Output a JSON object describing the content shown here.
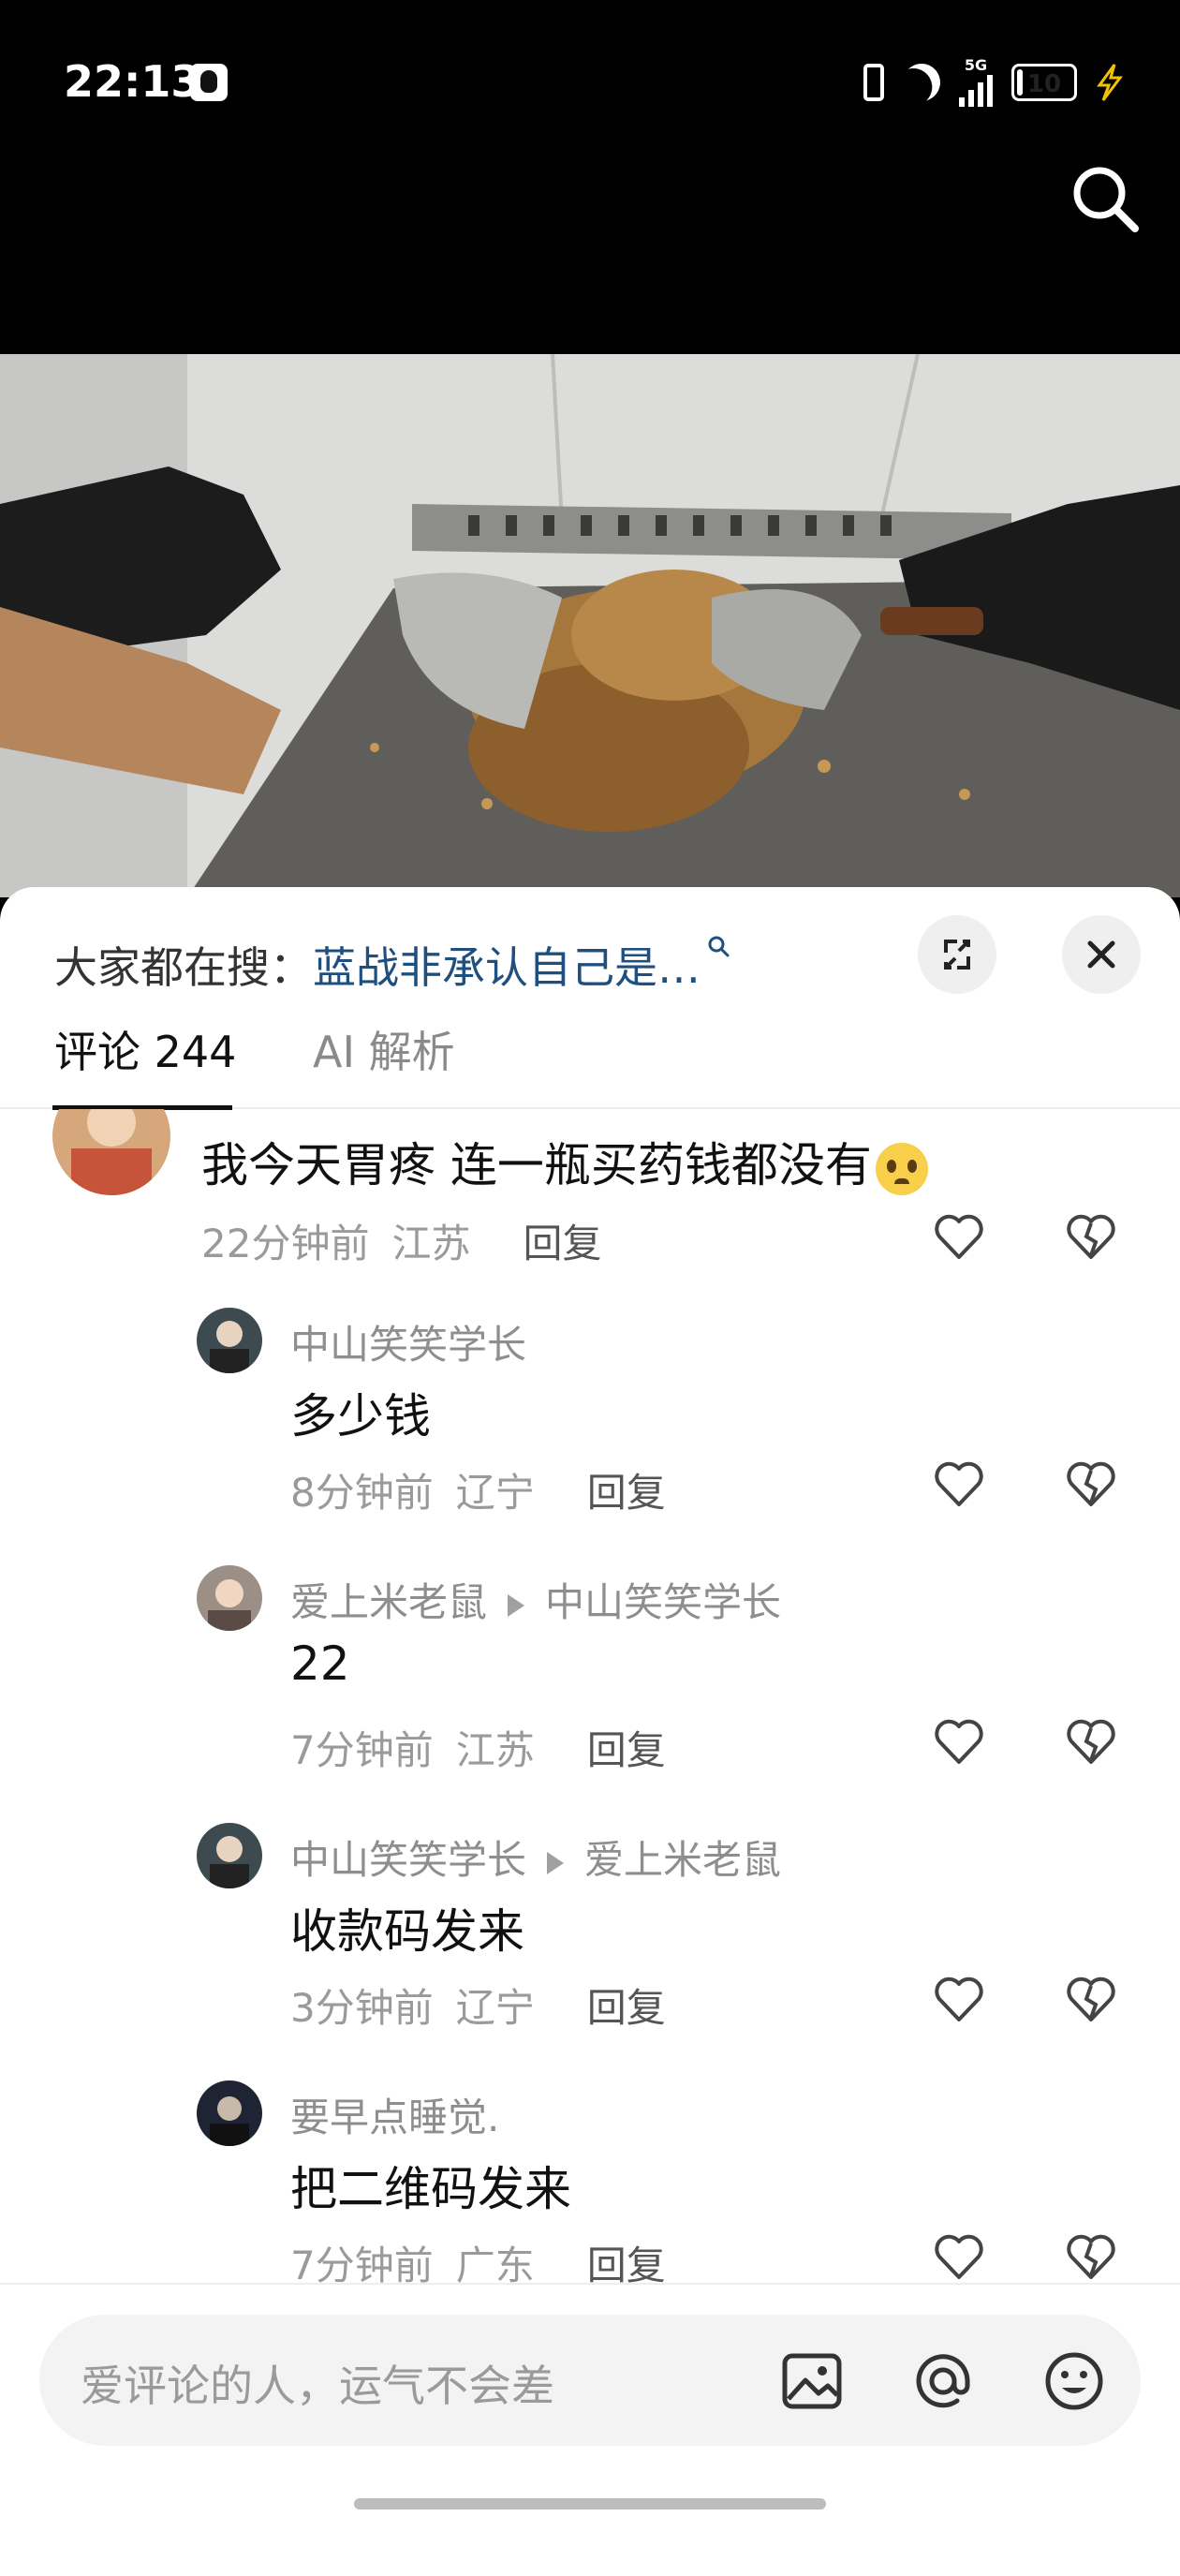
{
  "status_bar": {
    "time": "22:13",
    "network": "5G",
    "battery": "10",
    "battery_level": 0.1
  },
  "panel": {
    "trending_prefix": "大家都在搜：",
    "trending_query": "蓝战非承认自己是…",
    "tabs": [
      {
        "label": "评论 244",
        "active": true
      },
      {
        "label": "AI 解析",
        "active": false
      }
    ]
  },
  "comments": [
    {
      "text": "我今天胃疼 连一瓶买药钱都没有",
      "time": "22分钟前",
      "location": "江苏",
      "reply": "回复"
    },
    {
      "name": "中山笑笑学长",
      "text": "多少钱",
      "time": "8分钟前",
      "location": "辽宁",
      "reply": "回复"
    },
    {
      "name": "爱上米老鼠",
      "reply_to": "中山笑笑学长",
      "text": "22",
      "time": "7分钟前",
      "location": "江苏",
      "reply": "回复"
    },
    {
      "name": "中山笑笑学长",
      "reply_to": "爱上米老鼠",
      "text": "收款码发来",
      "time": "3分钟前",
      "location": "辽宁",
      "reply": "回复"
    },
    {
      "name": "要早点睡觉.",
      "text": "把二维码发来",
      "time": "7分钟前",
      "location": "广东",
      "reply": "回复"
    }
  ],
  "input": {
    "placeholder": "爱评论的人，运气不会差"
  },
  "colors": {
    "link": "#1f4f7f",
    "meta": "#9a9a9a",
    "panel_bg": "#ffffff"
  }
}
